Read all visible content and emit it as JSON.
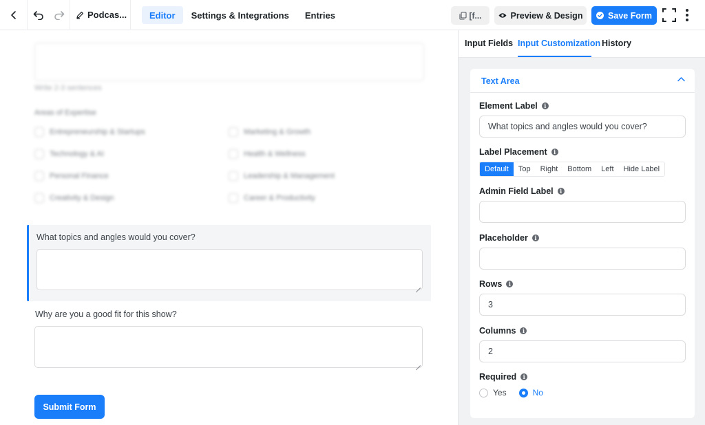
{
  "topbar": {
    "form_title": "Podcas...",
    "tabs": [
      {
        "label": "Editor",
        "active": true
      },
      {
        "label": "Settings & Integrations",
        "active": false
      },
      {
        "label": "Entries",
        "active": false
      }
    ],
    "shortcode_label": "[f...",
    "preview_label": "Preview & Design",
    "save_label": "Save Form"
  },
  "canvas": {
    "blurred": {
      "help_text": "Write 2-3 sentences",
      "group_label": "Areas of Expertise",
      "checkboxes": [
        "Entrepreneurship & Startups",
        "Marketing & Growth",
        "Technology & AI",
        "Health & Wellness",
        "Personal Finance",
        "Leadership & Management",
        "Creativity & Design",
        "Career & Productivity"
      ]
    },
    "active_field_label": "What topics and angles would you cover?",
    "second_field_label": "Why are you a good fit for this show?",
    "submit_label": "Submit Form"
  },
  "sidebar": {
    "tabs": [
      {
        "label": "Input Fields",
        "active": false
      },
      {
        "label": "Input Customization",
        "active": true
      },
      {
        "label": "History",
        "active": false
      }
    ],
    "panel_title": "Text Area",
    "element_label": {
      "label": "Element Label",
      "value": "What topics and angles would you cover?"
    },
    "label_placement": {
      "label": "Label Placement",
      "options": [
        "Default",
        "Top",
        "Right",
        "Bottom",
        "Left",
        "Hide Label"
      ],
      "selected": "Default"
    },
    "admin_field_label": {
      "label": "Admin Field Label",
      "value": ""
    },
    "placeholder": {
      "label": "Placeholder",
      "value": ""
    },
    "rows": {
      "label": "Rows",
      "value": "3"
    },
    "columns": {
      "label": "Columns",
      "value": "2"
    },
    "required": {
      "label": "Required",
      "options": [
        "Yes",
        "No"
      ],
      "selected": "No"
    },
    "info_glyph": "i"
  },
  "colors": {
    "accent": "#1a7efb",
    "panel_bg": "#f1f2f4",
    "active_field_bg": "#f4f5f6"
  }
}
